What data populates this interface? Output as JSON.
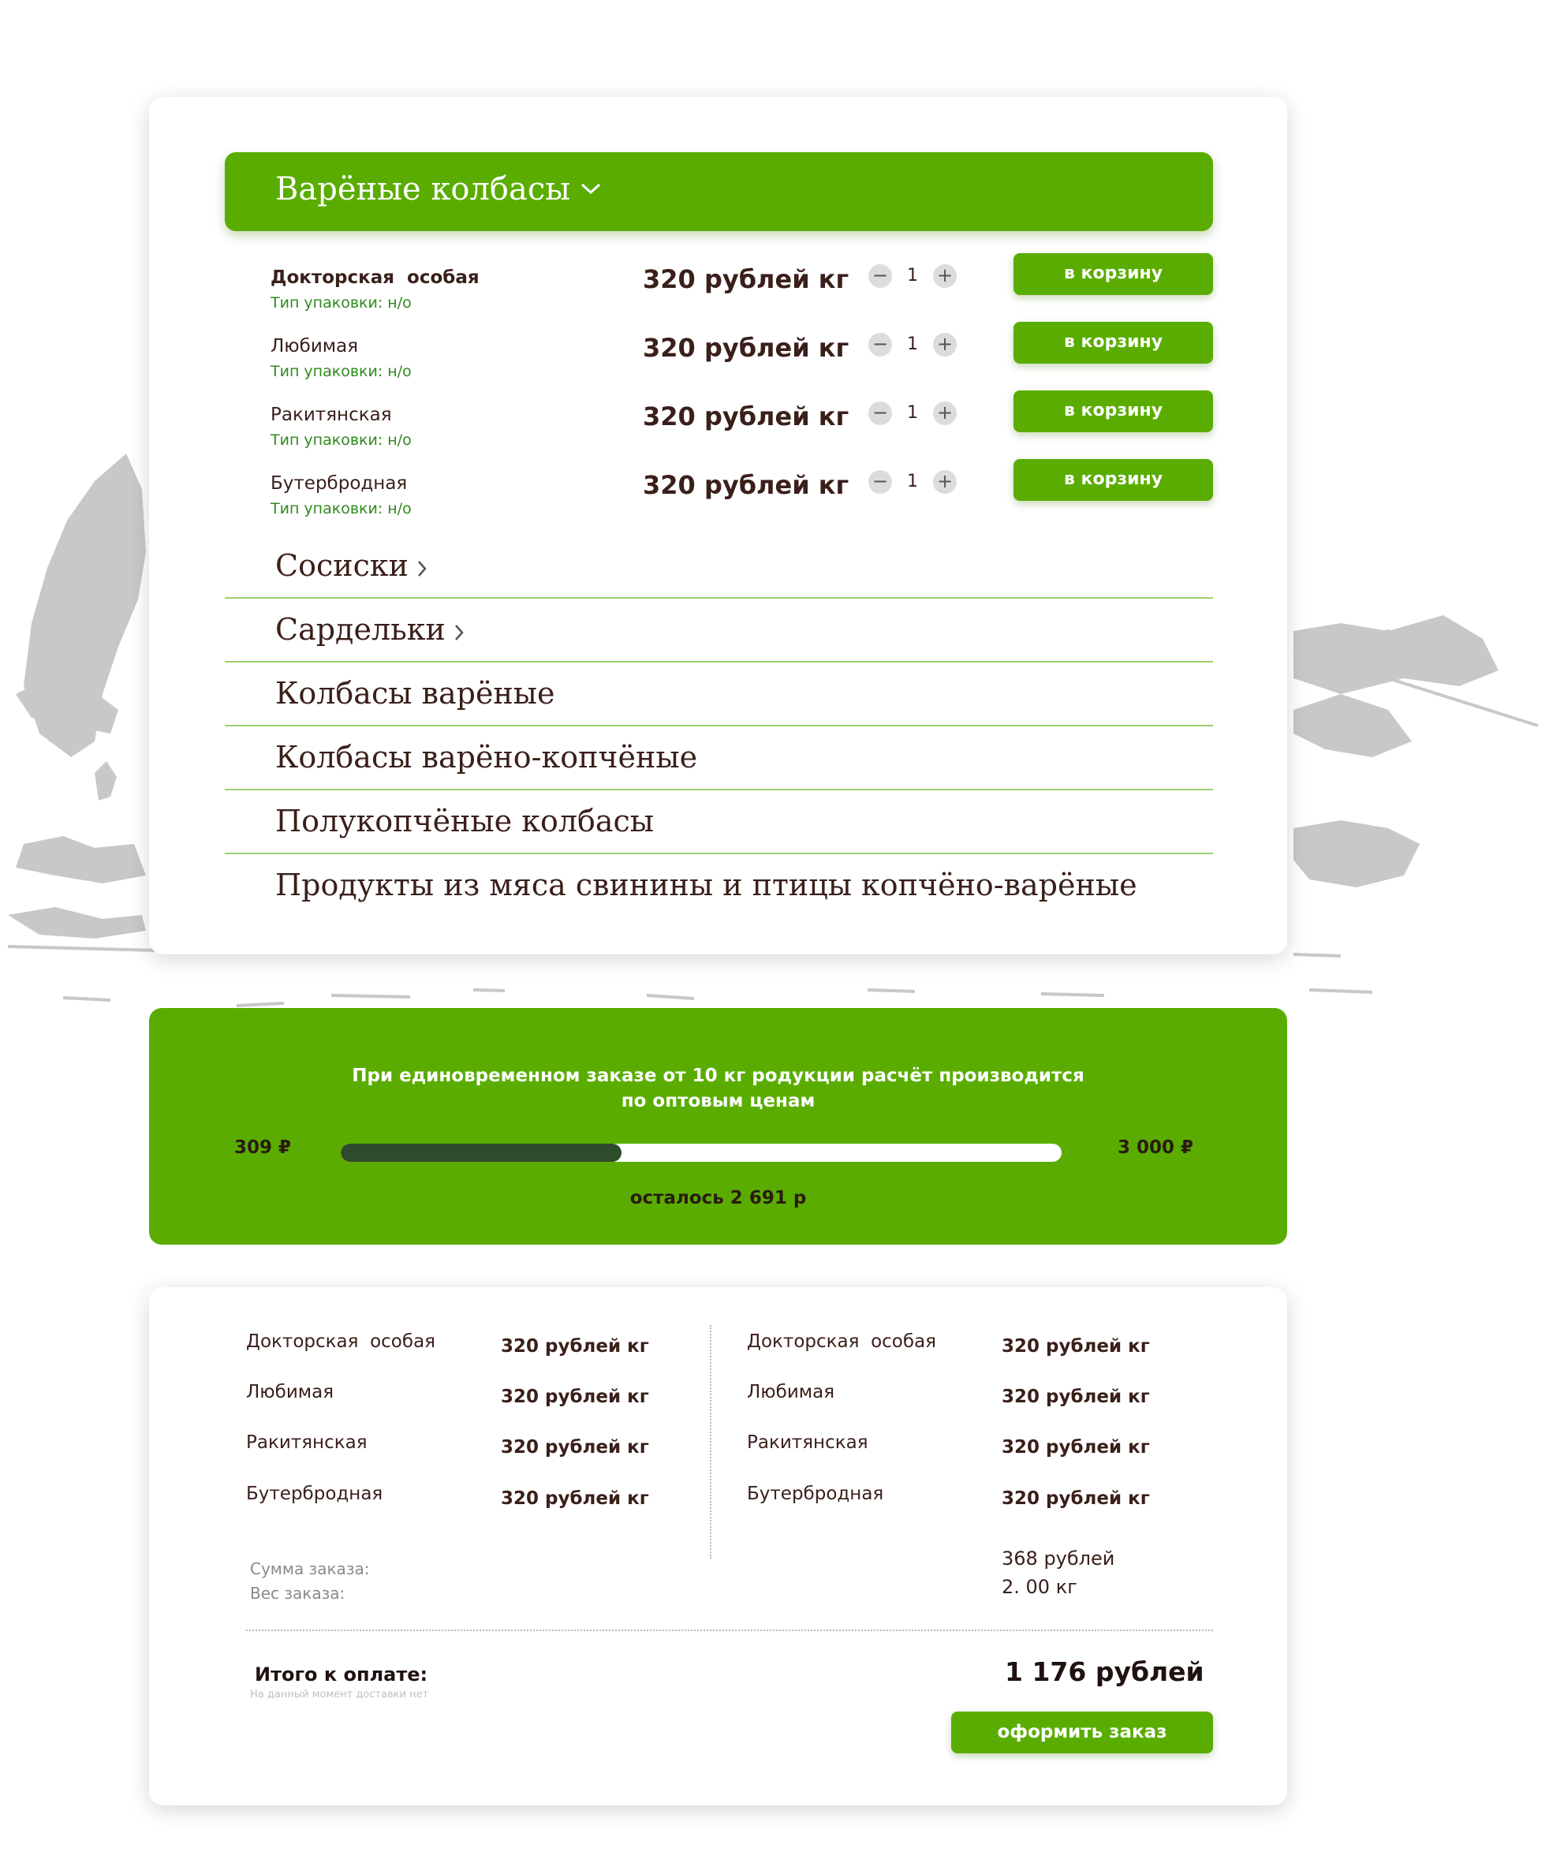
{
  "catalog": {
    "open_category": "Варёные колбасы",
    "products": [
      {
        "name": "Докторская  особая",
        "pack": "Тип упаковки: н/о",
        "price": "320 рублей кг",
        "qty": "1",
        "cart_label": "в корзину",
        "bold": true
      },
      {
        "name": "Любимая",
        "pack": "Тип упаковки: н/о",
        "price": "320 рублей кг",
        "qty": "1",
        "cart_label": "в корзину",
        "bold": false
      },
      {
        "name": "Ракитянская",
        "pack": "Тип упаковки: н/о",
        "price": "320 рублей кг",
        "qty": "1",
        "cart_label": "в корзину",
        "bold": false
      },
      {
        "name": "Бутербродная",
        "pack": "Тип упаковки: н/о",
        "price": "320 рублей кг",
        "qty": "1",
        "cart_label": "в корзину",
        "bold": false
      }
    ],
    "categories": [
      {
        "label": "Сосиски",
        "has_arrow": true
      },
      {
        "label": "Сардельки",
        "has_arrow": true
      },
      {
        "label": "Колбасы варёные",
        "has_arrow": false
      },
      {
        "label": "Колбасы варёно-копчёные",
        "has_arrow": false
      },
      {
        "label": "Полукопчёные колбасы",
        "has_arrow": false
      },
      {
        "label": "Продукты из мяса свинины и птицы копчёно-варёные",
        "has_arrow": false
      }
    ]
  },
  "wholesale": {
    "line1": "При единовременном заказе от 10 кг родукции расчёт производится",
    "line2": "по оптовым ценам",
    "current": "309 ₽",
    "target": "3 000 ₽",
    "progress_fraction": 0.39,
    "remaining": "осталось 2 691 р"
  },
  "order": {
    "left": [
      {
        "name": "Докторская  особая",
        "price": "320 рублей кг"
      },
      {
        "name": "Любимая",
        "price": "320 рублей кг"
      },
      {
        "name": "Ракитянская",
        "price": "320 рублей кг"
      },
      {
        "name": "Бутербродная",
        "price": "320 рублей кг"
      }
    ],
    "right": [
      {
        "name": "Докторская  особая",
        "price": "320 рублей кг"
      },
      {
        "name": "Любимая",
        "price": "320 рублей кг"
      },
      {
        "name": "Ракитянская",
        "price": "320 рублей кг"
      },
      {
        "name": "Бутербродная",
        "price": "320 рублей кг"
      }
    ],
    "sum_label": "Сумма заказа:",
    "weight_label": "Вес заказа:",
    "sum_value": "368 рублей",
    "weight_value": "2. 00 кг",
    "total_label": "Итого к оплате:",
    "total_note": "На данный момент доставки нет",
    "total_value": "1 176 рублей",
    "checkout_label": "оформить заказ"
  },
  "colors": {
    "accent": "#5aad00",
    "progress_fill": "#2e4b2b",
    "text": "#3a1f1a",
    "pack_text": "#2f8a1d"
  }
}
